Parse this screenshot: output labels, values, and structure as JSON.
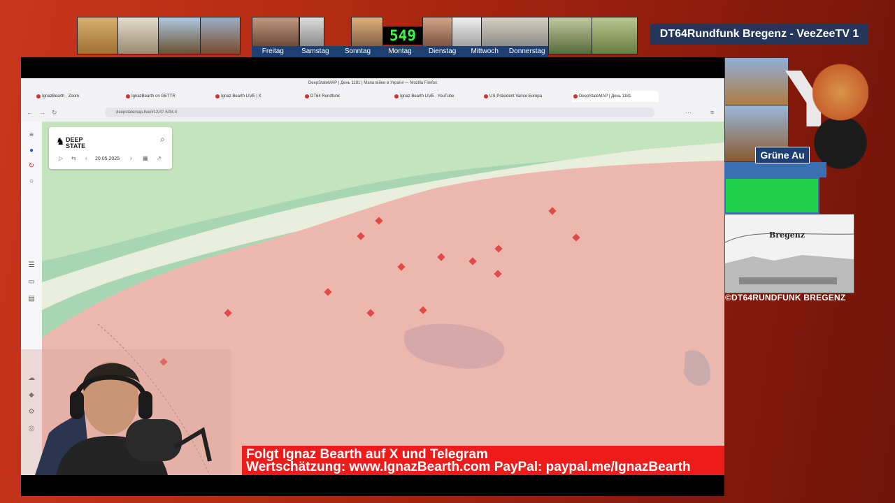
{
  "stream": {
    "station_title": "DT64Rundfunk Bregenz - VeeZeeTV 1",
    "counter": "549",
    "days": [
      "Freitag",
      "Samstag",
      "Sonntag",
      "Montag",
      "Dienstag",
      "Mittwoch",
      "Donnerstag"
    ],
    "location_badge": "Grüne Au",
    "sketch_label": "Bregenz",
    "copyright": "©DT64RUNDFUNK BREGENZ"
  },
  "browser": {
    "window_title": "DeepStateMAP | День 1181 | Мапа війни в Україні — Mozilla Firefox",
    "tabs": [
      {
        "label": "IgnazBearth · Zoom",
        "active": false
      },
      {
        "label": "IgnazBearth on GETTR",
        "active": false
      },
      {
        "label": "Ignaz Bearth LIVE | X",
        "active": false
      },
      {
        "label": "DT64 Rundfunk",
        "active": false
      },
      {
        "label": "Ignaz Bearth LIVE · YouTube",
        "active": false
      },
      {
        "label": "US-Präsident Vance Europa",
        "active": false
      },
      {
        "label": "DeepStateMAP | День 1181",
        "active": true
      }
    ],
    "url": "deepstatemap.live/#12/47.5/34.4"
  },
  "map_panel": {
    "logo": "DEEP STATE",
    "date": "20.05.2025"
  },
  "banner": {
    "line1": "Folgt Ignaz Bearth auf X und Telegram",
    "line2": "Wertschätzung: www.IgnazBearth.com PayPal: paypal.me/IgnazBearth"
  }
}
